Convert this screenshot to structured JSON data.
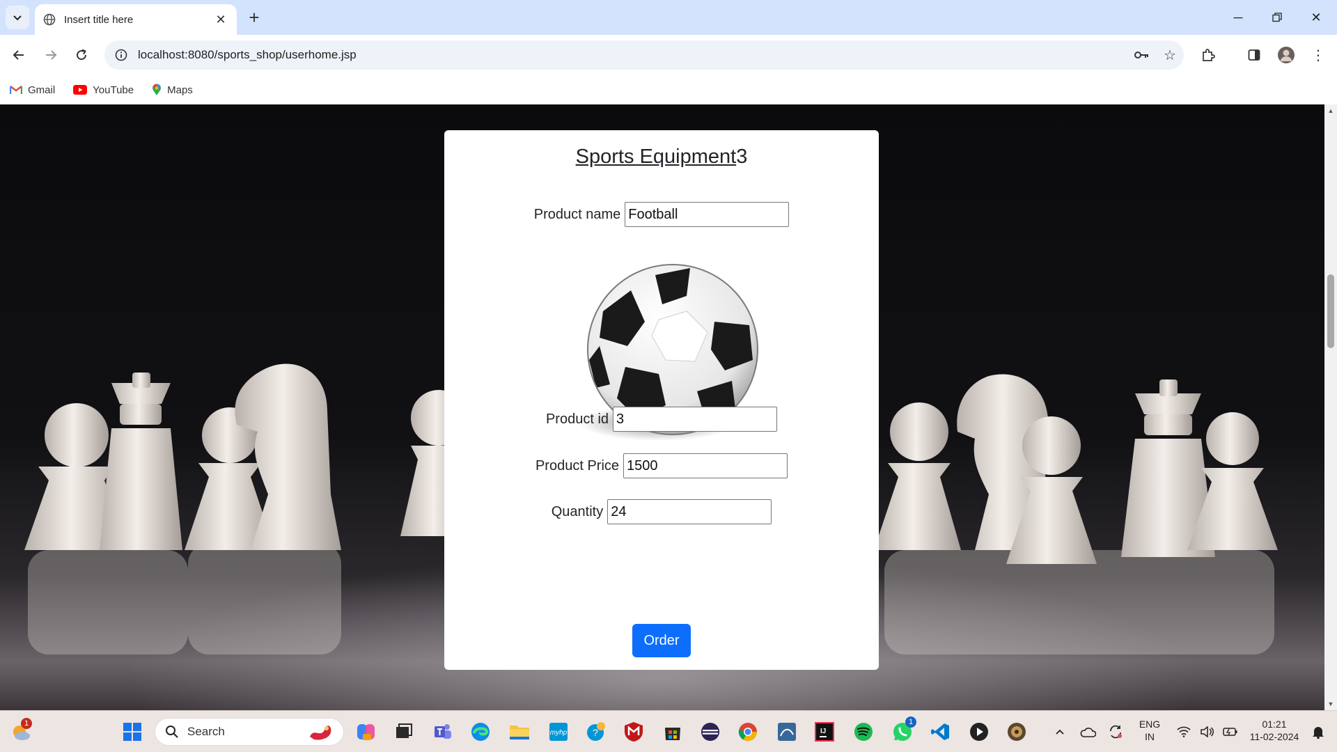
{
  "browser": {
    "tab_title": "Insert title here",
    "url": "localhost:8080/sports_shop/userhome.jsp",
    "bookmarks": [
      {
        "label": "Gmail",
        "icon": "gmail-icon"
      },
      {
        "label": "YouTube",
        "icon": "youtube-icon"
      },
      {
        "label": "Maps",
        "icon": "maps-icon"
      }
    ]
  },
  "page": {
    "title_underlined": "Sports Equipment",
    "title_suffix": "3",
    "product_name_label": "Product name",
    "product_name_value": "Football",
    "product_id_label": "Product id",
    "product_id_value": "3",
    "product_price_label": "Product Price",
    "product_price_value": "1500",
    "quantity_label": "Quantity",
    "quantity_value": "24",
    "order_button": "Order",
    "image_icon": "soccer-ball-image"
  },
  "taskbar": {
    "search_placeholder": "Search",
    "language_line1": "ENG",
    "language_line2": "IN",
    "time": "01:21",
    "date": "11-02-2024",
    "weather_badge": "1",
    "whatsapp_badge": "1"
  },
  "colors": {
    "tabbar": "#d3e3fd",
    "order_button": "#0d6efd",
    "taskbar": "#ece5e2"
  }
}
